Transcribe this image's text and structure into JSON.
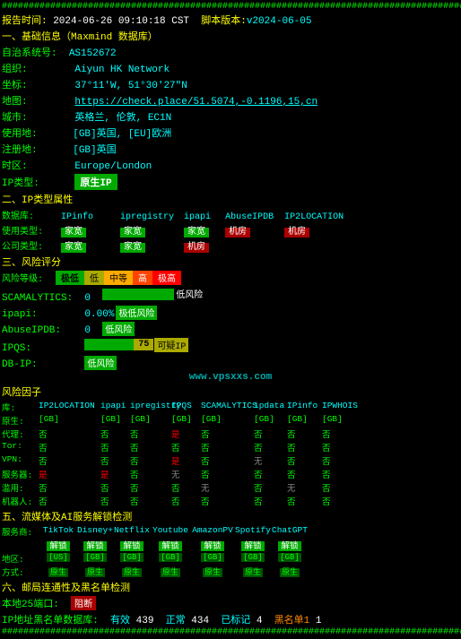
{
  "header": {
    "hash_line": "##############################################################################################################",
    "report_time_label": "报告时间:",
    "report_time": "2024-06-26 09:10:18 CST",
    "script_label": "脚本版本:",
    "script_version": "v2024-06-05"
  },
  "section1": {
    "title": "一、基础信息（Maxmind 数据库）",
    "as_label": "自治系统号:",
    "as_value": "AS152672",
    "org_label": "组织:",
    "org_value": "Aiyun HK Network",
    "coords_label": "坐标:",
    "coords_value": "37°11'W, 51°30'27\"N",
    "map_label": "地图:",
    "map_link": "https://check.place/51.5074,-0.1196,15,cn",
    "city_label": "城市:",
    "city_value": "英格兰, 伦敦, EC1N",
    "usage_label": "使用地:",
    "usage_value": "[GB]英国, [EU]欧洲",
    "reg_label": "注册地:",
    "reg_value": "[GB]英国",
    "tz_label": "时区:",
    "tz_value": "Europe/London",
    "ip_type_label": "IP类型:",
    "ip_type_badge": "原生IP"
  },
  "section2": {
    "title": "二、IP类型属性",
    "db_label": "数据库:",
    "db_ipinfo": "IPinfo",
    "db_ipreg": "ipregistry",
    "db_ipapi": "ipapi",
    "db_abuseipdb": "AbuseIPDB",
    "db_ip2loc": "IP2LOCATION",
    "usage_type_label": "使用类型:",
    "cell_jiayu1": "家宽",
    "cell_jiayu2": "家宽",
    "cell_jiayu3": "家宽",
    "cell_jifang1": "机房",
    "cell_jifang2": "机房",
    "cell_jifang3": "机房",
    "company_label": "公司类型:",
    "cell_comp1": "家宽",
    "cell_comp2": "家宽",
    "cell_comp3": "机房"
  },
  "section3": {
    "title": "三、风险评分",
    "risk_level_label": "风险等级:",
    "risk_level_low": "极低",
    "risk_level_mid": "低",
    "risk_level_med": "中等",
    "risk_level_high": "高",
    "risk_level_extreme": "极高",
    "scam_label": "SCAMALYTICS:",
    "scam_value": "0",
    "scam_text": "低风险",
    "ipapi_label": "ipapi:",
    "ipapi_value": "0.00%",
    "ipapi_text": "极低风险",
    "abuseipdb_label": "AbuseIPDB:",
    "abuseipdb_value": "0",
    "abuseipdb_text": "低风险",
    "ipqs_label": "IPQS:",
    "ipqs_value": "75",
    "ipqs_badge": "可疑IP",
    "dbip_label": "DB-IP:",
    "dbip_text": "低风险",
    "watermark": "www.vpsxxs.com"
  },
  "section_risk_factors": {
    "title": "风险因子",
    "col_source": "库:",
    "col_ip2loc": "IP2LOCATION",
    "col_ipapi": "ipapi",
    "col_ipreg": "ipregistry",
    "col_ipqs": "IPQS",
    "col_scam": "SCAMALYTICS",
    "col_ipdata": "ipdata",
    "col_ipinfo": "IPinfo",
    "col_ipwhois": "IPWHOIS",
    "row_country_label": "原生:",
    "row_isp_label": "代理:",
    "row_tor_label": "Tor:",
    "row_vpn_label": "VPN:",
    "row_server_label": "服务器:",
    "row_misuse_label": "滥用:",
    "row_bot_label": "机器人:",
    "gb_tags": [
      "[GB]",
      "[GB]",
      "[GB]",
      "[GB]",
      "[GB]",
      "[GB]",
      "[GB]",
      "[GB]"
    ],
    "no_tags": [
      "否",
      "否",
      "否",
      "否",
      "否",
      "否",
      "否",
      "否"
    ],
    "yes_tag": "是",
    "none_tag": "无",
    "proxy_row": [
      "否",
      "否",
      "否",
      "是",
      "否",
      "否",
      "否",
      "否"
    ],
    "tor_row": [
      "否",
      "否",
      "否",
      "否",
      "否",
      "否",
      "否",
      "否"
    ],
    "vpn_row": [
      "否",
      "否",
      "否",
      "是",
      "否",
      "无",
      "否",
      "否"
    ],
    "server_row": [
      "是",
      "是",
      "否",
      "无",
      "否",
      "否",
      "否",
      "否"
    ],
    "misuse_row": [
      "否",
      "否",
      "否",
      "否",
      "无",
      "否",
      "无",
      "否"
    ],
    "bot_row": [
      "否",
      "否",
      "否",
      "否",
      "否",
      "否",
      "否",
      "否"
    ]
  },
  "section5": {
    "title": "五、流媒体及AI服务解锁检测",
    "service_label": "服务商:",
    "s_tiktok": "TikTok",
    "s_disneyp": "Disney+",
    "s_netflix": "Netflix",
    "s_youtube": "Youtube",
    "s_amazonpv": "AmazonPV",
    "s_spotify": "Spotify",
    "s_chatgpt": "ChatGPT",
    "unlock1": "解锁",
    "unlock2": "解锁",
    "unlock3": "解锁",
    "unlock4": "解锁",
    "unlock5": "解锁",
    "unlock6": "解锁",
    "unlock7": "解锁",
    "region_label": "地区:",
    "reg1": "[US]",
    "reg2": "[GB]",
    "reg3": "[GB]",
    "reg4": "[GB]",
    "reg5": "[GB]",
    "reg6": "[GB]",
    "reg7": "[GB]",
    "method_label": "方式:",
    "m1": "原生",
    "m2": "原生",
    "m3": "原生",
    "m4": "原生",
    "m5": "原生",
    "m6": "原生",
    "m7": "原生"
  },
  "section6": {
    "title": "六、邮局连通性及黑名单检测",
    "port25_label": "本地25端口:",
    "port25_value": "阻断",
    "blacklist_label": "IP地址黑名单数据库:",
    "valid": "有效",
    "valid_count": "439",
    "correct": "正常",
    "correct_count": "434",
    "marked": "已标记",
    "marked_count": "4",
    "blacklisted": "黑名单1",
    "blacklisted_count": "1"
  }
}
